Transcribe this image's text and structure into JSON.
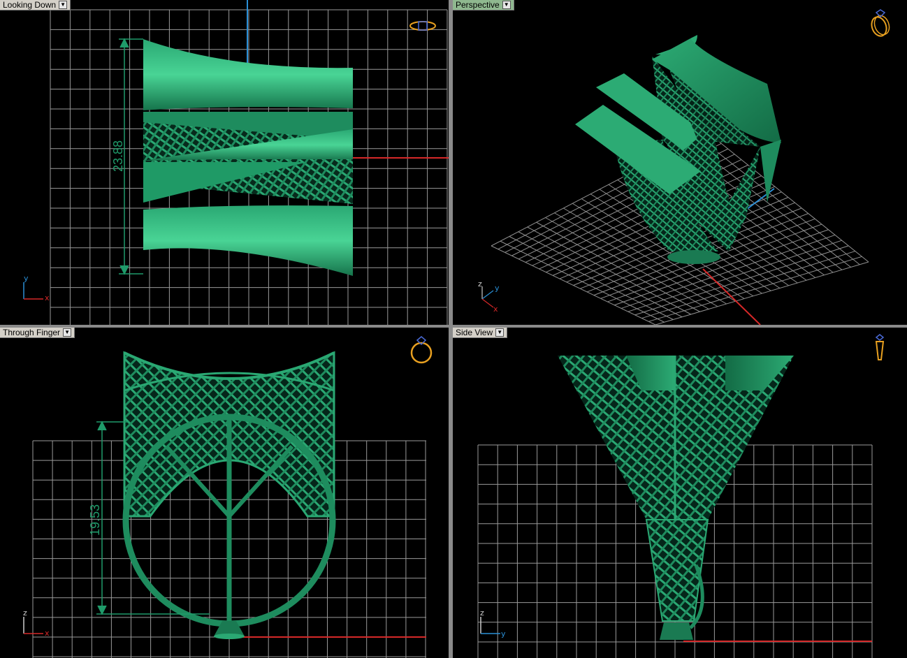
{
  "viewports": [
    {
      "id": "top",
      "label": "Looking Down",
      "active": false,
      "dimension": "23.88",
      "axes": {
        "vertical": "y",
        "horizontal": "x"
      },
      "nav_icon": "ring-top-icon"
    },
    {
      "id": "persp",
      "label": "Perspective",
      "active": true,
      "axes": {
        "vertical": "z",
        "side": "y",
        "horizontal": "x"
      },
      "nav_icon": "ring-perspective-icon"
    },
    {
      "id": "front",
      "label": "Through Finger",
      "active": false,
      "dimension": "19.53",
      "axes": {
        "vertical": "z",
        "horizontal": "x"
      },
      "nav_icon": "ring-front-icon"
    },
    {
      "id": "side",
      "label": "Side View",
      "active": false,
      "axes": {
        "vertical": "z",
        "horizontal": "y"
      },
      "nav_icon": "ring-side-icon"
    }
  ],
  "colors": {
    "model": "#1e8c5e",
    "model_light": "#3fc58c",
    "model_dark": "#0f5e3c",
    "grid": "#b0b0b0",
    "x_axis": "#d62828",
    "y_axis": "#2a8fd6",
    "dimension": "#1f9b6a",
    "nav_icon": "#e8a020",
    "active_label": "#8fb88f"
  }
}
